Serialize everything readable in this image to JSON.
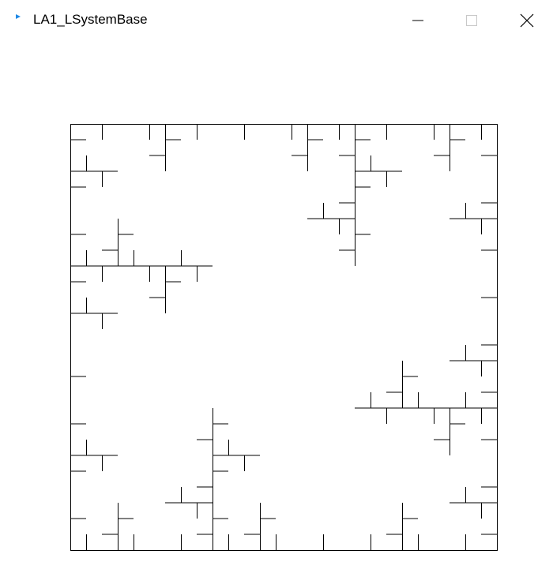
{
  "window": {
    "title": "LA1_LSystemBase"
  },
  "controls": {
    "minimize": "minimize-icon",
    "maximize": "maximize-icon",
    "close": "close-icon"
  },
  "colors": {
    "stroke": "#000000",
    "background": "#ffffff",
    "app_icon": "#1e88e5"
  }
}
